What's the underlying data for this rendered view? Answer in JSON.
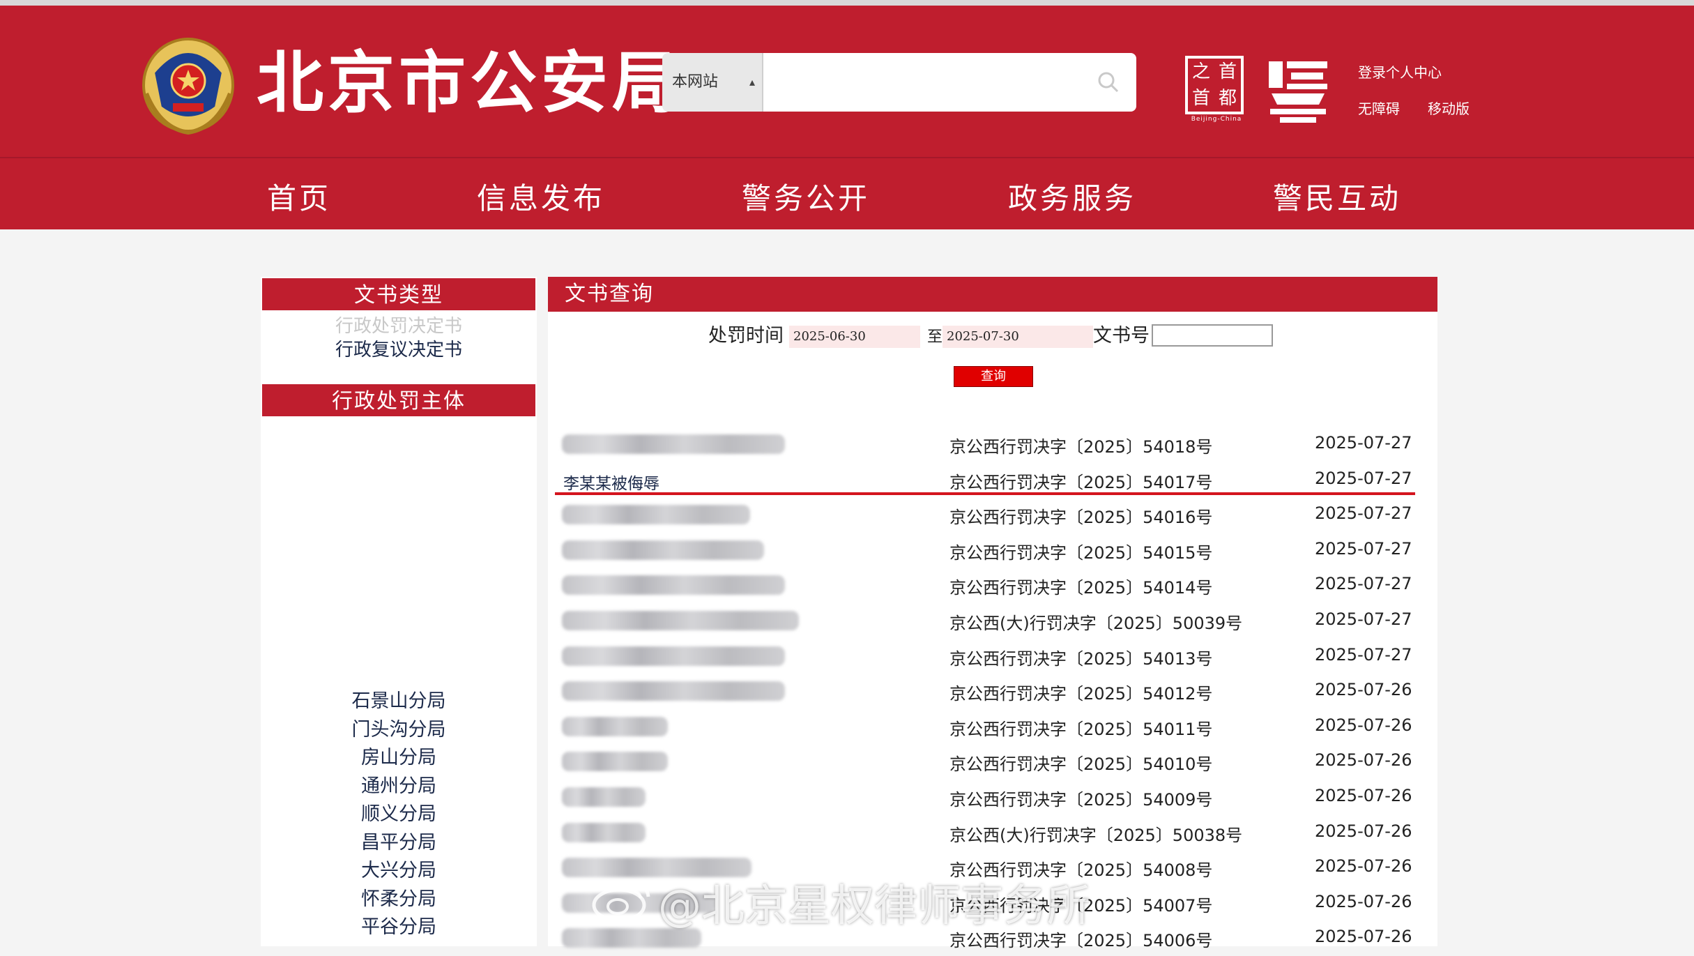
{
  "header": {
    "site_title": "北京市公安局",
    "search": {
      "scope": "本网站",
      "placeholder": ""
    },
    "capital_logo": {
      "chars": [
        "之",
        "首",
        "首",
        "都"
      ],
      "sub": "Beijing-China"
    },
    "links": {
      "login": "登录个人中心",
      "accessibility": "无障碍",
      "mobile": "移动版"
    }
  },
  "nav": {
    "items": [
      "首页",
      "信息发布",
      "警务公开",
      "政务服务",
      "警民互动"
    ]
  },
  "sidebar": {
    "doc_types_title": "文书类型",
    "doc_types": [
      {
        "label": "行政处罚决定书",
        "color": "#c8c8c8"
      },
      {
        "label": "行政复议决定书",
        "color": "#1c2a4a"
      }
    ],
    "subjects_title": "行政处罚主体",
    "branches": [
      "石景山分局",
      "门头沟分局",
      "房山分局",
      "通州分局",
      "顺义分局",
      "昌平分局",
      "大兴分局",
      "怀柔分局",
      "平谷分局"
    ]
  },
  "query": {
    "title": "文书查询",
    "time_label": "处罚时间",
    "date_from": "2025-06-30",
    "to_label": "至",
    "date_to": "2025-07-30",
    "docno_label": "文书号",
    "docno_value": "",
    "button": "查询"
  },
  "results": [
    {
      "name": "",
      "doc_no": "京公西行罚决字〔2025〕54018号",
      "date": "2025-07-27",
      "blur_w": 320
    },
    {
      "name": "李某某被侮辱",
      "doc_no": "京公西行罚决字〔2025〕54017号",
      "date": "2025-07-27",
      "highlight": true
    },
    {
      "name": "",
      "doc_no": "京公西行罚决字〔2025〕54016号",
      "date": "2025-07-27",
      "blur_w": 270
    },
    {
      "name": "",
      "doc_no": "京公西行罚决字〔2025〕54015号",
      "date": "2025-07-27",
      "blur_w": 290
    },
    {
      "name": "",
      "doc_no": "京公西行罚决字〔2025〕54014号",
      "date": "2025-07-27",
      "blur_w": 320
    },
    {
      "name": "",
      "doc_no": "京公西(大)行罚决字〔2025〕50039号",
      "date": "2025-07-27",
      "blur_w": 340
    },
    {
      "name": "",
      "doc_no": "京公西行罚决字〔2025〕54013号",
      "date": "2025-07-27",
      "blur_w": 320
    },
    {
      "name": "",
      "doc_no": "京公西行罚决字〔2025〕54012号",
      "date": "2025-07-26",
      "blur_w": 320
    },
    {
      "name": "",
      "doc_no": "京公西行罚决字〔2025〕54011号",
      "date": "2025-07-26",
      "blur_w": 152
    },
    {
      "name": "",
      "doc_no": "京公西行罚决字〔2025〕54010号",
      "date": "2025-07-26",
      "blur_w": 152
    },
    {
      "name": "",
      "doc_no": "京公西行罚决字〔2025〕54009号",
      "date": "2025-07-26",
      "blur_w": 120
    },
    {
      "name": "",
      "doc_no": "京公西(大)行罚决字〔2025〕50038号",
      "date": "2025-07-26",
      "blur_w": 120
    },
    {
      "name": "",
      "doc_no": "京公西行罚决字〔2025〕54008号",
      "date": "2025-07-26",
      "blur_w": 272
    },
    {
      "name": "",
      "doc_no": "京公西行罚决字〔2025〕54007号",
      "date": "2025-07-26",
      "blur_w": 220
    },
    {
      "name": "",
      "doc_no": "京公西行罚决字〔2025〕54006号",
      "date": "2025-07-26",
      "blur_w": 200
    }
  ],
  "watermark": "@北京星权律师事务所",
  "colors": {
    "brand_red": "#bf1e2e",
    "highlight_red": "#d4141e",
    "button_red": "#e00000"
  }
}
